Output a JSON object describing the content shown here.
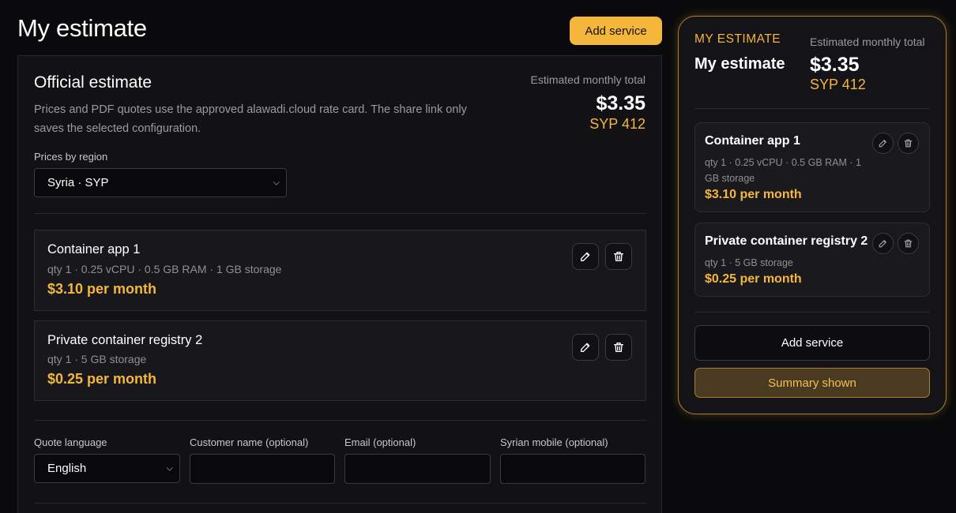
{
  "page": {
    "title": "My estimate",
    "add_service_label": "Add service"
  },
  "estimate": {
    "title": "Official estimate",
    "description": "Prices and PDF quotes use the approved alawadi.cloud rate card. The share link only saves the selected configuration.",
    "total_label": "Estimated monthly total",
    "total_usd": "$3.35",
    "total_syp": "SYP 412",
    "region_label": "Prices by region",
    "region_value": "Syria · SYP"
  },
  "services": [
    {
      "name": "Container app 1",
      "spec": "qty 1 · 0.25 vCPU · 0.5 GB RAM · 1 GB storage",
      "price": "$3.10 per month"
    },
    {
      "name": "Private container registry 2",
      "spec": "qty 1 · 5 GB storage",
      "price": "$0.25 per month"
    }
  ],
  "form": {
    "language_label": "Quote language",
    "language_value": "English",
    "customer_label": "Customer name (optional)",
    "email_label": "Email (optional)",
    "mobile_label": "Syrian mobile (optional)"
  },
  "summary": {
    "kicker": "MY ESTIMATE",
    "title": "My estimate",
    "total_label": "Estimated monthly total",
    "total_usd": "$3.35",
    "total_syp": "SYP 412",
    "add_service_label": "Add service",
    "summary_shown_label": "Summary shown"
  },
  "colors": {
    "accent": "#f5b73b",
    "background": "#0a0a0c",
    "panel": "#121215"
  },
  "icons": {
    "edit": "pencil-icon",
    "delete": "trash-icon",
    "dropdown": "chevron-down-icon"
  }
}
